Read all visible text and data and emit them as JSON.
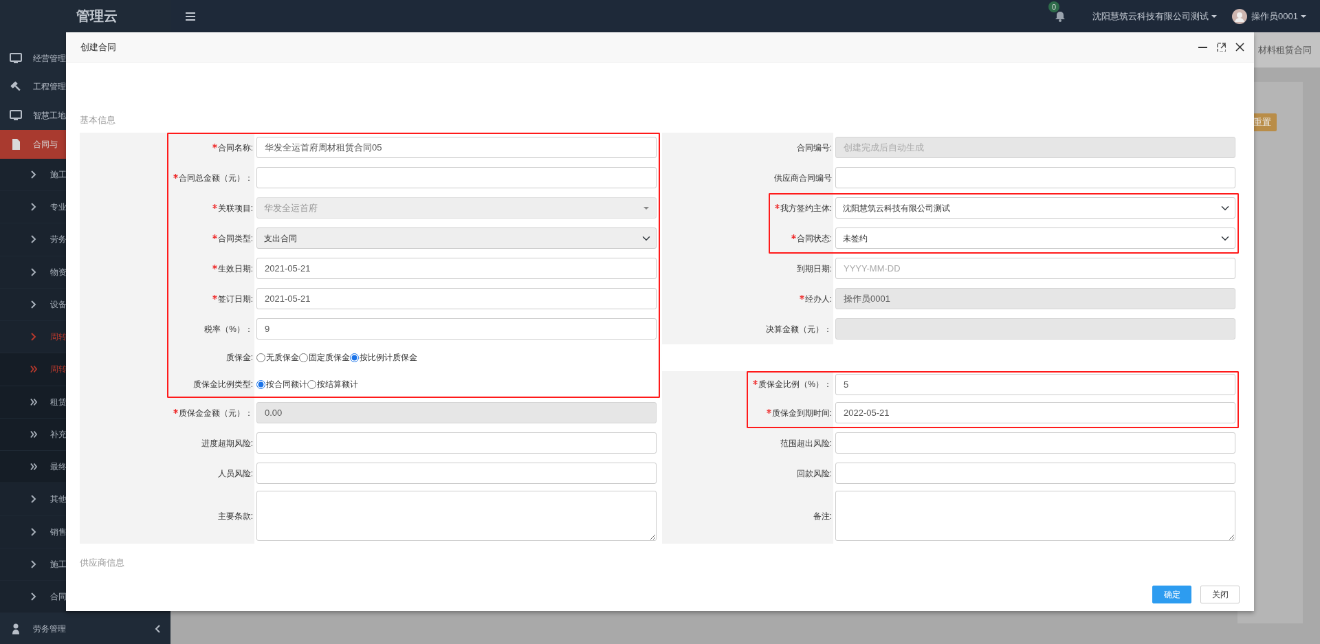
{
  "navbar": {
    "logo": "管理云",
    "notifications": "0",
    "company": "沈阳慧筑云科技有限公司测试",
    "user": "操作员0001"
  },
  "sidebar": {
    "items": [
      {
        "label": "经营管理",
        "selected": false
      },
      {
        "label": "工程管理",
        "selected": false
      },
      {
        "label": "智慧工地",
        "selected": false
      },
      {
        "label": "合同与",
        "selected": true,
        "children": [
          {
            "label": "施工",
            "selected": false
          },
          {
            "label": "专业",
            "selected": false
          },
          {
            "label": "劳务",
            "selected": false
          },
          {
            "label": "物资",
            "selected": false
          },
          {
            "label": "设备",
            "selected": false
          },
          {
            "label": "周转",
            "selected": true,
            "children": [
              {
                "label": "周转",
                "selected": true
              },
              {
                "label": "租赁",
                "selected": false
              },
              {
                "label": "补充",
                "selected": false
              },
              {
                "label": "最终",
                "selected": false
              }
            ]
          },
          {
            "label": "其他",
            "selected": false
          },
          {
            "label": "销售",
            "selected": false
          },
          {
            "label": "施工",
            "selected": false
          },
          {
            "label": "合同",
            "selected": false
          }
        ]
      },
      {
        "label": "劳务管理",
        "selected": false,
        "expanded": false
      }
    ]
  },
  "background": {
    "tab": "材料租赁合同",
    "reset_button": "重置"
  },
  "modal": {
    "title": "创建合同",
    "section_title": "基本信息",
    "rows": [
      {
        "left": {
          "label": "合同名称:",
          "required": true,
          "kind": "text",
          "value": "华发全运首府周材租赁合同05",
          "disabled": false,
          "highlighted": true
        },
        "right": {
          "label": "合同编号:",
          "required": false,
          "kind": "text",
          "placeholder": "创建完成后自动生成",
          "disabled": true,
          "highlighted": false
        }
      },
      {
        "left": {
          "label": "合同总金额（元）：",
          "required": true,
          "kind": "text",
          "disabled": false,
          "highlighted": true
        },
        "right": {
          "label": "供应商合同编号",
          "required": false,
          "kind": "text",
          "disabled": false,
          "highlighted": false
        }
      },
      {
        "left": {
          "label": "关联项目:",
          "required": true,
          "kind": "combobox",
          "value": "华发全运首府",
          "disabled": true,
          "highlighted": true
        },
        "right": {
          "label": "我方签约主体:",
          "required": true,
          "kind": "select",
          "value": "沈阳慧筑云科技有限公司测试",
          "disabled": false,
          "highlighted": true
        }
      },
      {
        "left": {
          "label": "合同类型:",
          "required": true,
          "kind": "select",
          "value": "支出合同",
          "disabled": true,
          "highlighted": true
        },
        "right": {
          "label": "合同状态:",
          "required": true,
          "kind": "select",
          "value": "未签约",
          "disabled": false,
          "highlighted": true
        }
      },
      {
        "left": {
          "label": "生效日期:",
          "required": true,
          "kind": "text",
          "value": "2021-05-21",
          "disabled": false,
          "highlighted": true
        },
        "right": {
          "label": "到期日期:",
          "required": false,
          "kind": "text",
          "placeholder": "YYYY-MM-DD",
          "disabled": false,
          "highlighted": false
        }
      },
      {
        "left": {
          "label": "签订日期:",
          "required": true,
          "kind": "text",
          "value": "2021-05-21",
          "disabled": false,
          "highlighted": true
        },
        "right": {
          "label": "经办人:",
          "required": true,
          "kind": "text",
          "value": "操作员0001",
          "disabled": true,
          "highlighted": false
        }
      },
      {
        "left": {
          "label": "税率（%）：",
          "required": false,
          "kind": "text",
          "value": "9",
          "disabled": false,
          "highlighted": true
        },
        "right": {
          "label": "决算金额（元）：",
          "required": false,
          "kind": "text",
          "disabled": true,
          "highlighted": false
        }
      },
      {
        "left": {
          "label": "质保金:",
          "required": false,
          "kind": "radio",
          "highlighted": true,
          "options": [
            {
              "label": "无质保金",
              "selected": false
            },
            {
              "label": "固定质保金",
              "selected": false
            },
            {
              "label": "按比例计质保金",
              "selected": true
            }
          ]
        }
      },
      {
        "left": {
          "label": "质保金比例类型:",
          "required": false,
          "kind": "radio",
          "highlighted": true,
          "options": [
            {
              "label": "按合同额计",
              "selected": true
            },
            {
              "label": "按结算额计",
              "selected": false
            }
          ]
        },
        "right": {
          "label": "质保金比例（%）：",
          "required": true,
          "kind": "text",
          "value": "5",
          "disabled": false,
          "highlighted": true
        }
      },
      {
        "left": {
          "label": "质保金金额（元）：",
          "required": true,
          "kind": "text",
          "value": "0.00",
          "disabled": true,
          "highlighted": false
        },
        "right": {
          "label": "质保金到期时间:",
          "required": true,
          "kind": "text",
          "value": "2022-05-21",
          "disabled": false,
          "highlighted": true
        }
      },
      {
        "left": {
          "label": "进度超期风险:",
          "required": false,
          "kind": "text",
          "disabled": false,
          "highlighted": false
        },
        "right": {
          "label": "范围超出风险:",
          "required": false,
          "kind": "text",
          "disabled": false,
          "highlighted": false
        }
      },
      {
        "left": {
          "label": "人员风险:",
          "required": false,
          "kind": "text",
          "disabled": false,
          "highlighted": false
        },
        "right": {
          "label": "回款风险:",
          "required": false,
          "kind": "text",
          "disabled": false,
          "highlighted": false
        }
      },
      {
        "left": {
          "label": "主要条款:",
          "required": false,
          "kind": "textarea",
          "disabled": false,
          "highlighted": false
        },
        "right": {
          "label": "备注:",
          "required": false,
          "kind": "textarea",
          "disabled": false,
          "highlighted": false
        }
      }
    ],
    "next_section": "供应商信息",
    "buttons": [
      {
        "label": "确定",
        "kind": "primary"
      },
      {
        "label": "关闭",
        "kind": "default"
      }
    ]
  }
}
